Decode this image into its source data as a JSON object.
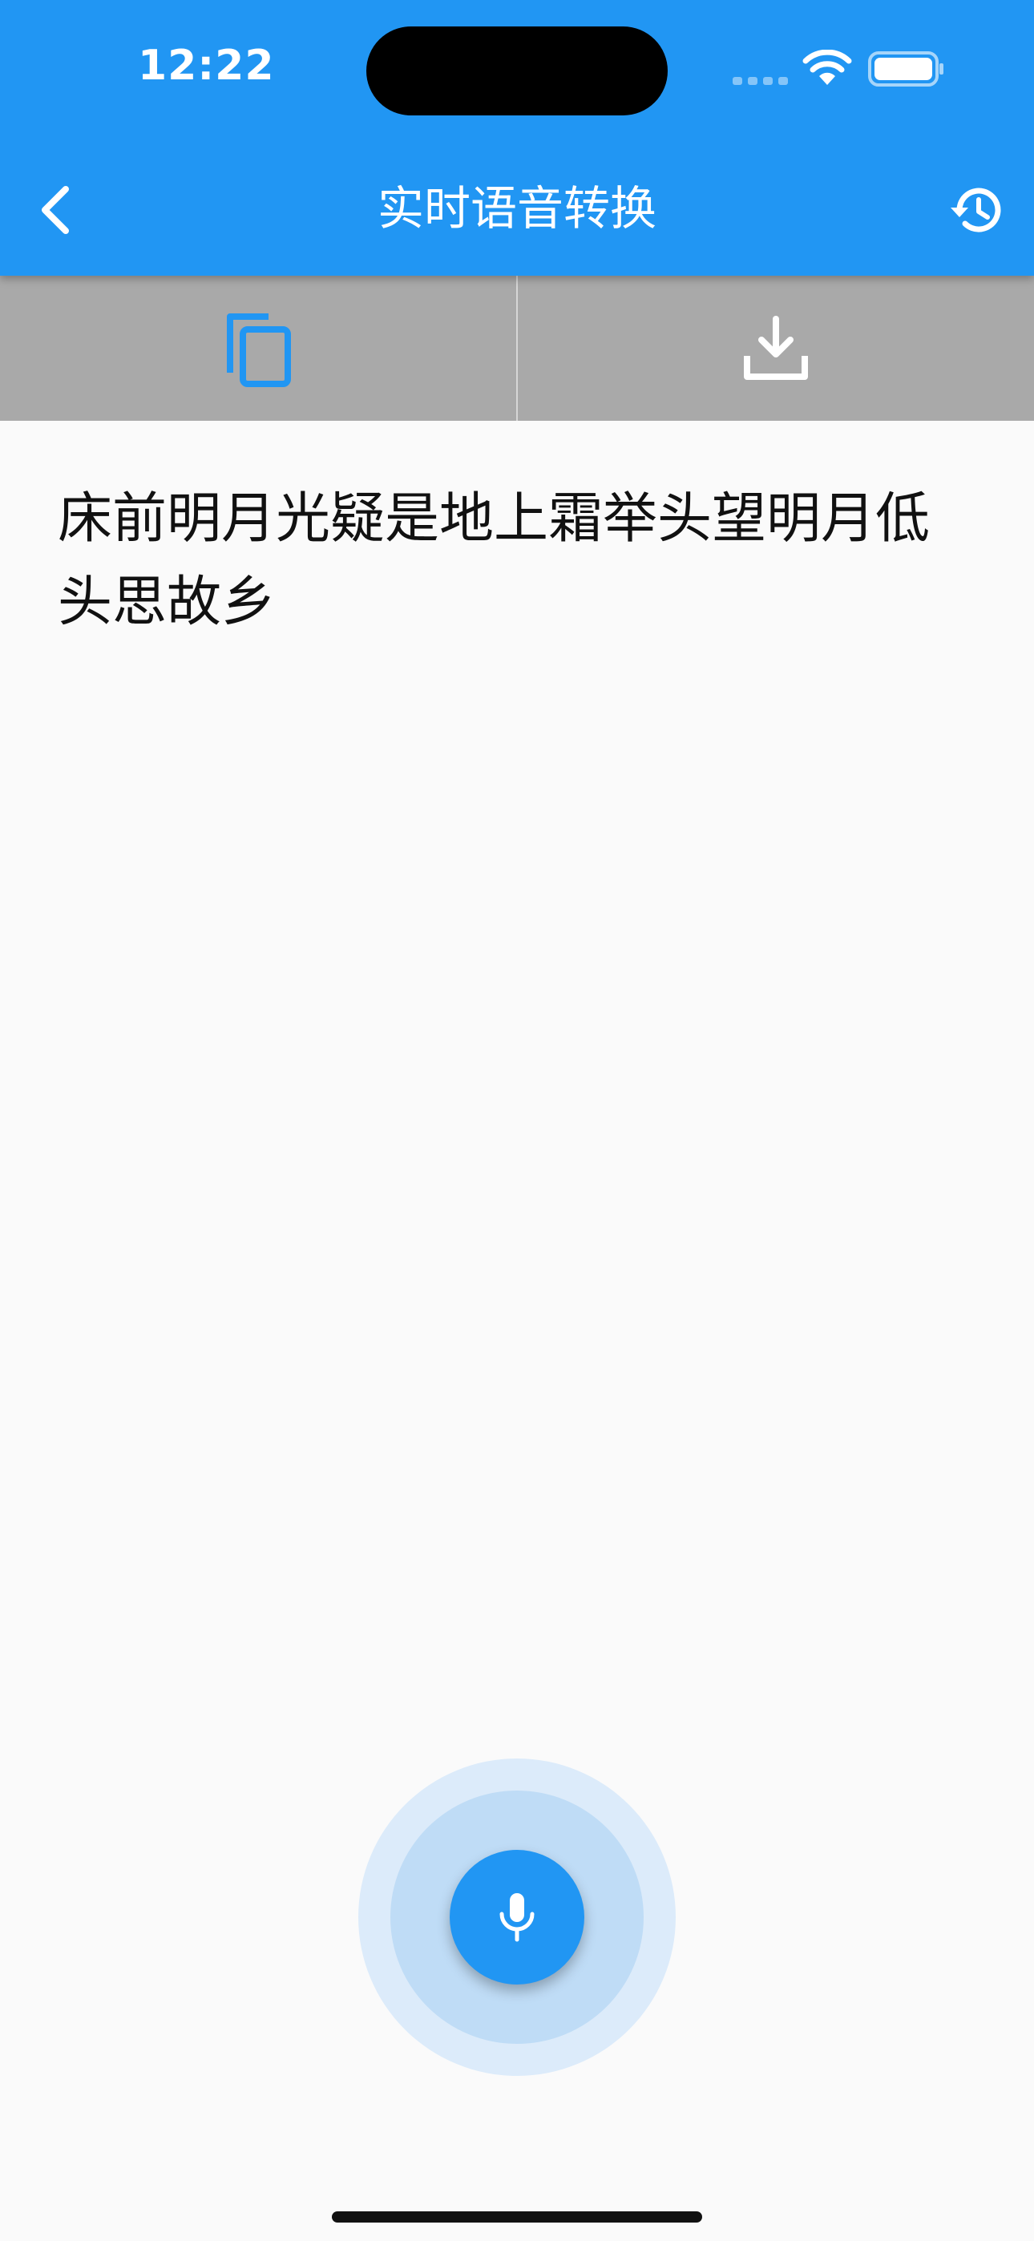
{
  "status_bar": {
    "time": "12:22"
  },
  "header": {
    "title": "实时语音转换",
    "back_icon": "chevron-left-icon",
    "history_icon": "history-icon",
    "background_color": "#2196F3"
  },
  "toolbar": {
    "copy_icon": "copy-icon",
    "download_icon": "download-icon",
    "background_color": "#A9A9A9"
  },
  "transcript": {
    "text": "床前明月光疑是地上霜举头望明月低头思故乡"
  },
  "mic": {
    "icon": "microphone-icon",
    "color": "#2196F3"
  }
}
